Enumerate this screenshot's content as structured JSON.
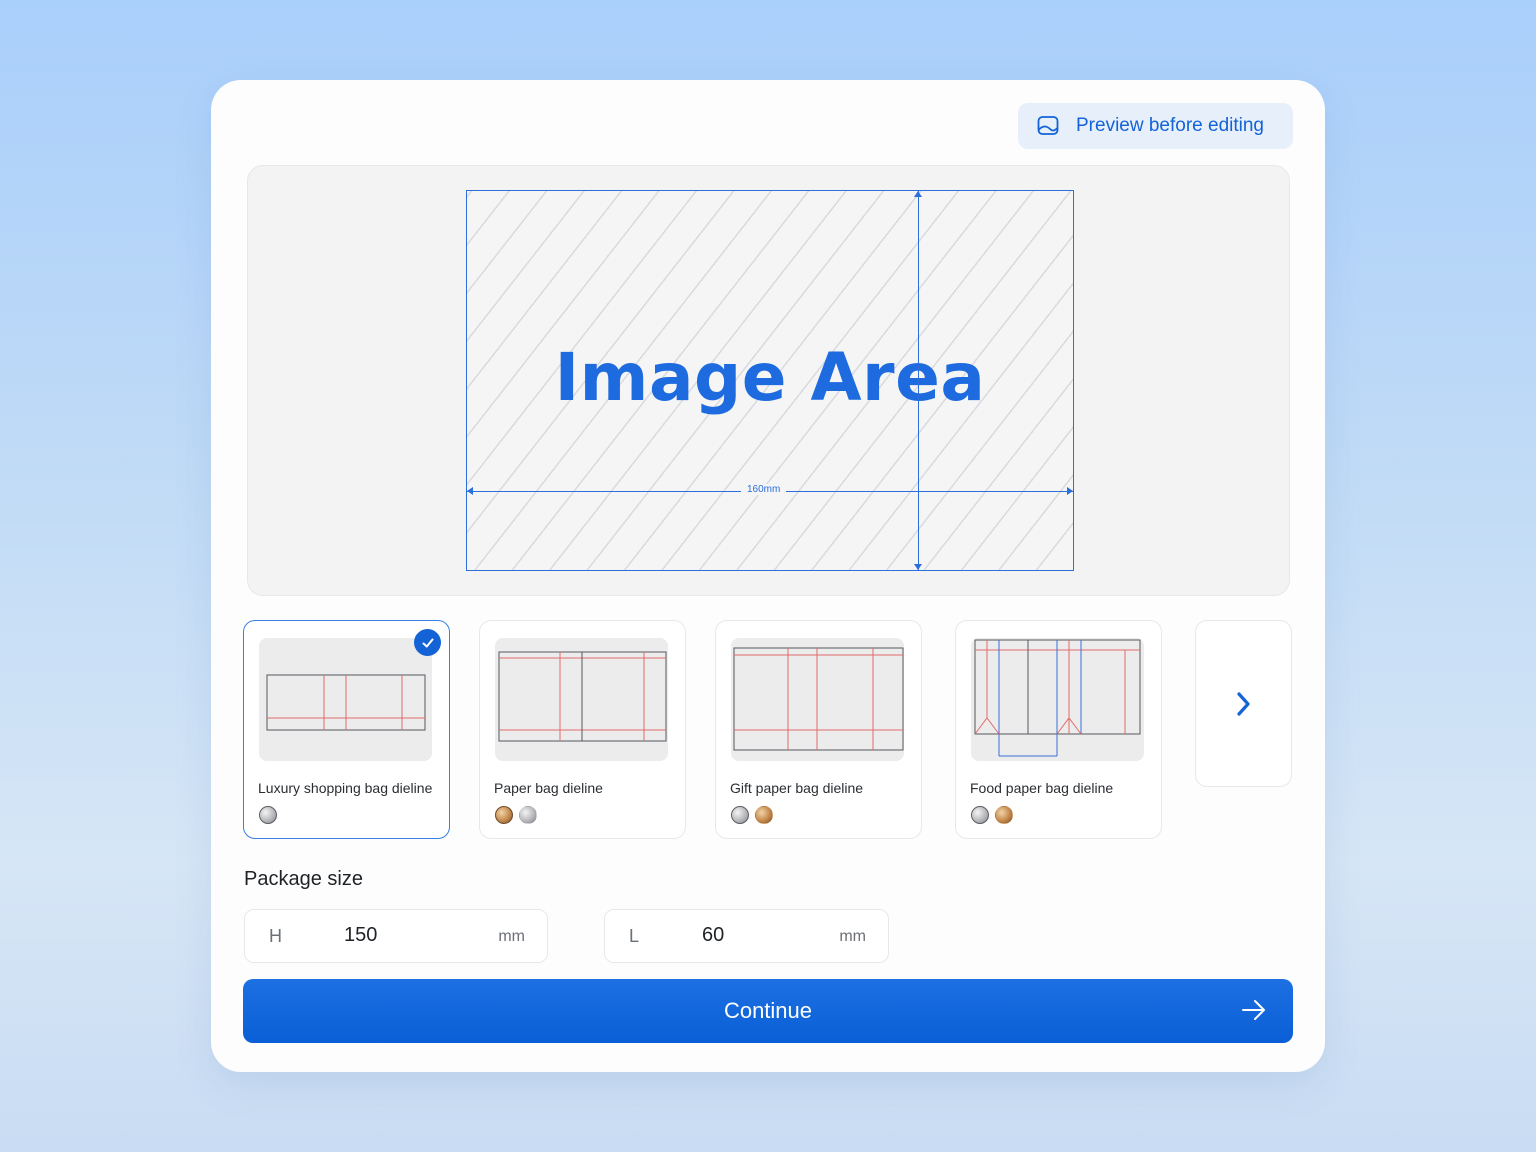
{
  "header": {
    "preview_label": "Preview before editing"
  },
  "canvas": {
    "image_area_label": "Image Area",
    "width_dimension": "160mm"
  },
  "templates": [
    {
      "name": "Luxury shopping bag dieline",
      "selected": true,
      "finishes": [
        "silver"
      ]
    },
    {
      "name": "Paper bag dieline",
      "selected": false,
      "finishes": [
        "gold",
        "silver"
      ]
    },
    {
      "name": "Gift paper bag dieline",
      "selected": false,
      "finishes": [
        "silver",
        "gold"
      ]
    },
    {
      "name": "Food paper bag dieline",
      "selected": false,
      "finishes": [
        "silver",
        "gold"
      ]
    }
  ],
  "package_size": {
    "title": "Package size",
    "height": {
      "prefix": "H",
      "value": "150",
      "unit": "mm"
    },
    "length": {
      "prefix": "L",
      "value": "60",
      "unit": "mm"
    }
  },
  "actions": {
    "continue_label": "Continue"
  },
  "colors": {
    "accent": "#1463d6",
    "dieline_red": "#e36a6a",
    "dieline_blue": "#3a6fd8"
  },
  "icons": {
    "preview": "image-frame-icon",
    "next": "chevron-right-icon",
    "continue": "arrow-right-icon",
    "selected": "check-icon"
  }
}
